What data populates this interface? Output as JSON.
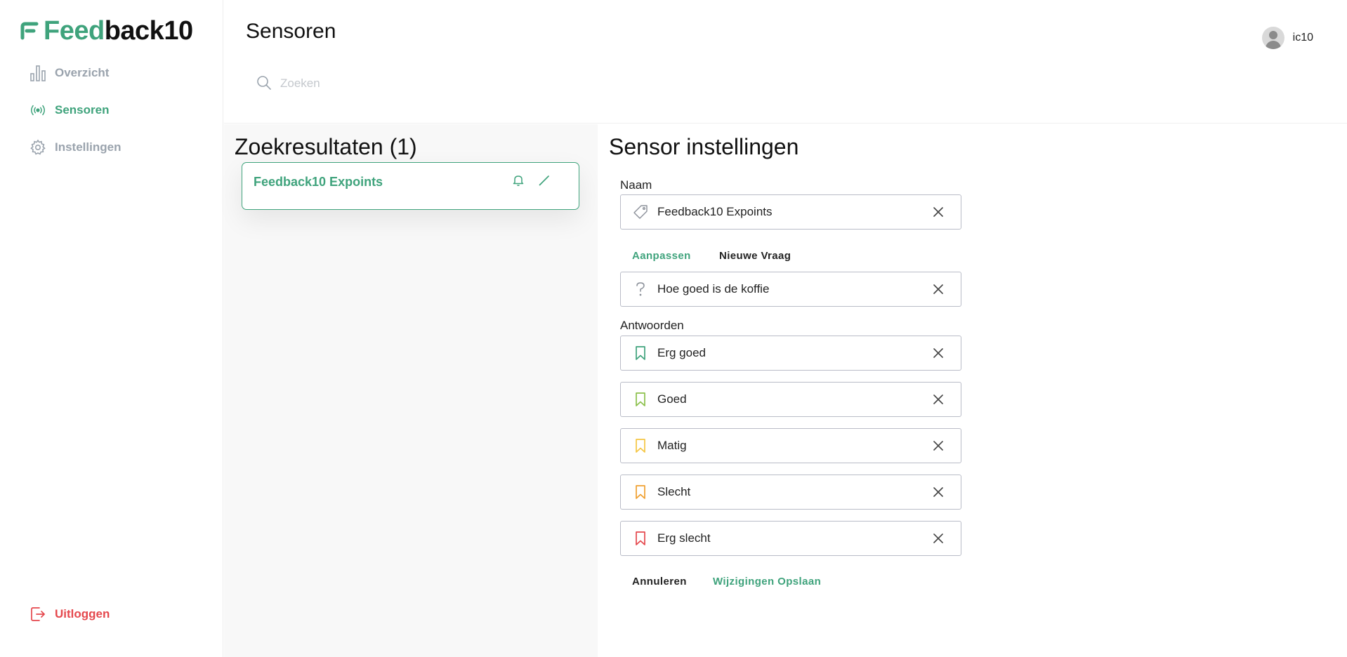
{
  "brand": {
    "part1": "Feed",
    "part2": "back10",
    "green": "#3fa37c",
    "dark": "#111111"
  },
  "sidebar": {
    "items": [
      {
        "label": "Overzicht",
        "icon": "bar-chart-icon"
      },
      {
        "label": "Sensoren",
        "icon": "broadcast-icon",
        "active": true
      },
      {
        "label": "Instellingen",
        "icon": "gear-icon"
      }
    ],
    "logout": {
      "label": "Uitloggen",
      "icon": "logout-icon",
      "color": "#e5484d"
    }
  },
  "header": {
    "title": "Sensoren",
    "search_placeholder": "Zoeken",
    "user": {
      "name": "ic10",
      "icon": "avatar-icon"
    }
  },
  "results": {
    "title": "Zoekresultaten (1)",
    "items": [
      {
        "name": "Feedback10 Expoints",
        "actions": [
          "bell-icon",
          "pencil-icon"
        ]
      }
    ]
  },
  "settings": {
    "title": "Sensor instellingen",
    "name_label": "Naam",
    "name_value": "Feedback10 Expoints",
    "tabs": [
      {
        "label": "Aanpassen",
        "active": true
      },
      {
        "label": "Nieuwe Vraag",
        "active": false
      }
    ],
    "question_value": "Hoe goed is de koffie",
    "answers_label": "Antwoorden",
    "answers": [
      {
        "label": "Erg goed",
        "color": "#3fa37c"
      },
      {
        "label": "Goed",
        "color": "#8cc04b"
      },
      {
        "label": "Matig",
        "color": "#f5c542"
      },
      {
        "label": "Slecht",
        "color": "#f0a030"
      },
      {
        "label": "Erg slecht",
        "color": "#e5484d"
      }
    ],
    "cancel_label": "Annuleren",
    "save_label": "Wijzigingen Opslaan"
  }
}
